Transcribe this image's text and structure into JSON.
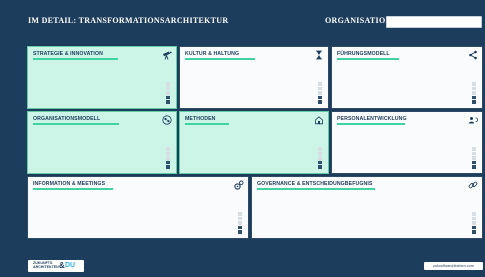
{
  "header": {
    "title": "IM DETAIL: TRANSFORMATIONSARCHITEKTUR",
    "org_label": "ORGANISATION:",
    "org_value": ""
  },
  "colors": {
    "background": "#1d3d5c",
    "card_white": "#fafbfc",
    "card_green": "#cdf5e7",
    "accent": "#3fd3a1",
    "meter_filled": "#2f4f6d",
    "meter_empty": "#d6dde3"
  },
  "cards": [
    {
      "title": "STRATEGIE & INNOVATION",
      "icon": "telescope-icon",
      "highlighted": true
    },
    {
      "title": "KULTUR & HALTUNG",
      "icon": "hourglass-icon",
      "highlighted": false
    },
    {
      "title": "FÜHRUNGSMODELL",
      "icon": "share-icon",
      "highlighted": false
    },
    {
      "title": "ORGANISATIONSMODELL",
      "icon": "network-icon",
      "highlighted": true
    },
    {
      "title": "METHODEN",
      "icon": "house-icon",
      "highlighted": true
    },
    {
      "title": "PERSONALENTWICKLUNG",
      "icon": "person-refresh-icon",
      "highlighted": false
    },
    {
      "title": "INFORMATION & MEETINGS",
      "icon": "gears-icon",
      "highlighted": false
    },
    {
      "title": "GOVERNANCE & ENTSCHEIDUNGBEFUGNIS",
      "icon": "chain-link-icon",
      "highlighted": false
    }
  ],
  "footer": {
    "logo_line1": "ZUKUNFTS",
    "logo_line2": "ARCHITEKTEN",
    "logo_amp": "&",
    "logo_du": "DU",
    "link": "zukunftsarchitekten.com"
  }
}
